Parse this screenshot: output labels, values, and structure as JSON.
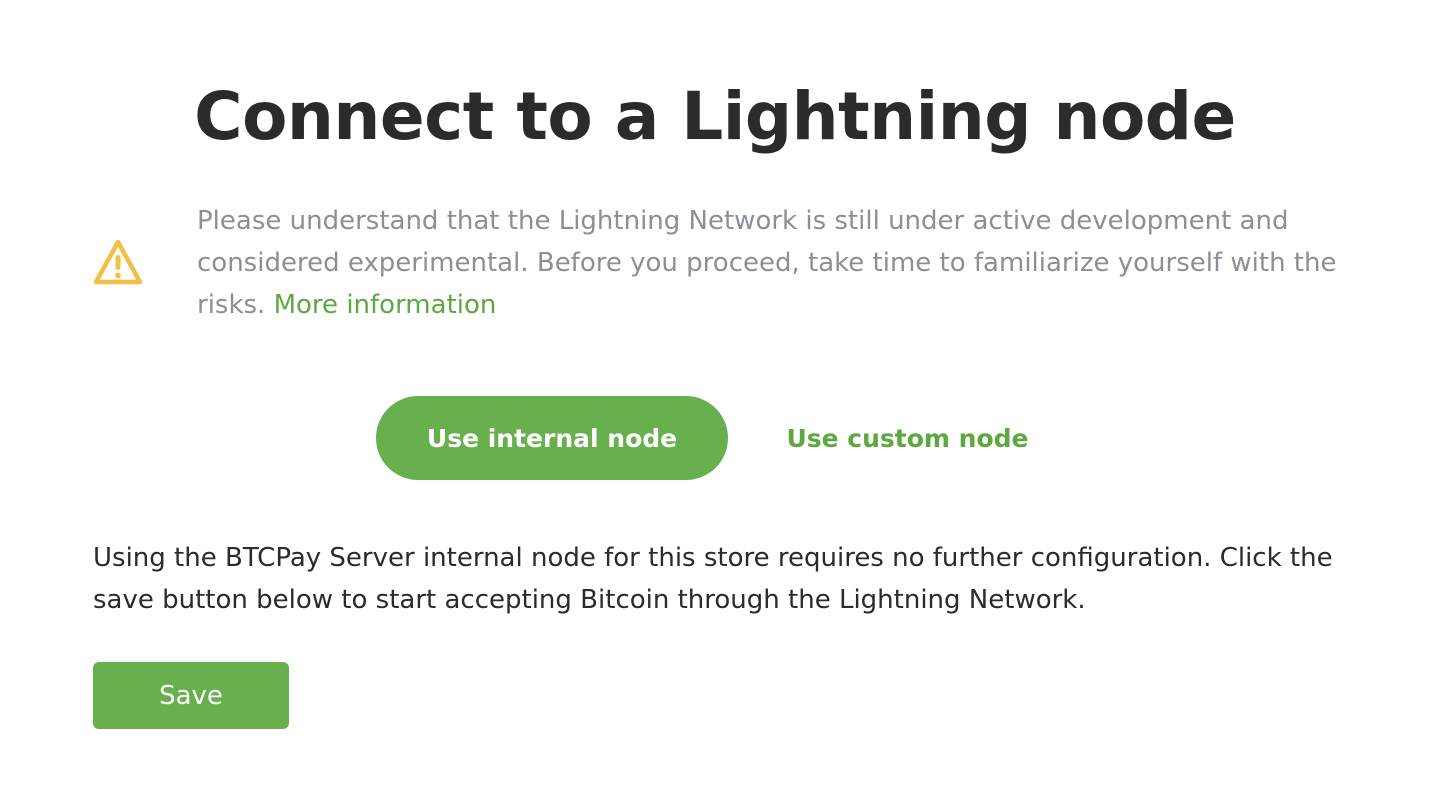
{
  "page": {
    "title": "Connect to a Lightning node"
  },
  "warning": {
    "icon": "warning-triangle-icon",
    "icon_color": "#f2c043",
    "text": "Please understand that the Lightning Network is still under active development and considered experimental. Before you proceed, take time to familiarize yourself with the risks.",
    "link_label": "More information"
  },
  "node_toggle": {
    "internal_label": "Use internal node",
    "custom_label": "Use custom node",
    "selected": "internal"
  },
  "info": {
    "text": "Using the BTCPay Server internal node for this store requires no further configuration. Click the save button below to start accepting Bitcoin through the Lightning Network."
  },
  "actions": {
    "save_label": "Save"
  },
  "colors": {
    "accent": "#68af4e",
    "link": "#5ea842",
    "muted_text": "#8a9096",
    "body_text": "#2b2b2b"
  }
}
